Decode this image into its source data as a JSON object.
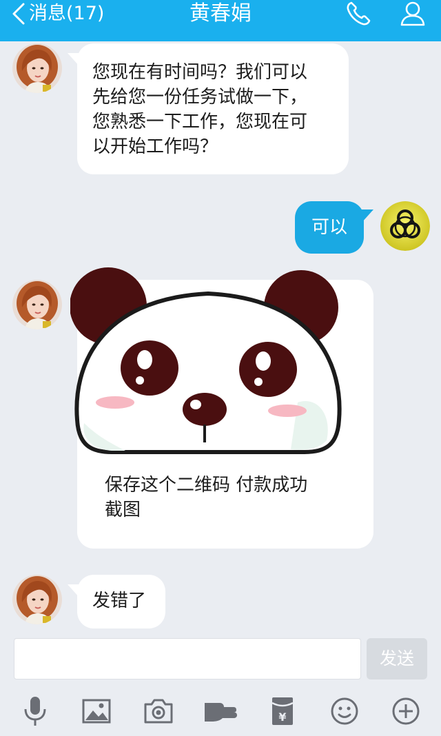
{
  "header": {
    "back_label": "消息(17)",
    "title": "黄春娟"
  },
  "messages": [
    {
      "side": "left",
      "text": "您现在有时间吗？我们可以\n先给您一份任务试做一下，\n您熟悉一下工作，您现在可\n以开始工作吗？"
    },
    {
      "side": "right",
      "text": "可以"
    },
    {
      "side": "left",
      "type": "image",
      "image": "panda-sticker",
      "caption": "保存这个二维码  付款成功\n截图"
    },
    {
      "side": "left",
      "text": "发错了"
    }
  ],
  "input": {
    "value": "",
    "send_label": "发送"
  },
  "toolbar": {
    "icons": [
      "microphone-icon",
      "image-icon",
      "camera-icon",
      "poke-hand-icon",
      "red-packet-icon",
      "emoji-icon",
      "plus-icon"
    ]
  },
  "colors": {
    "header": "#1ab0ee",
    "background": "#eaedf2",
    "own_bubble": "#1aa9e3",
    "other_bubble": "#ffffff",
    "send_disabled": "#d7dbe0"
  }
}
